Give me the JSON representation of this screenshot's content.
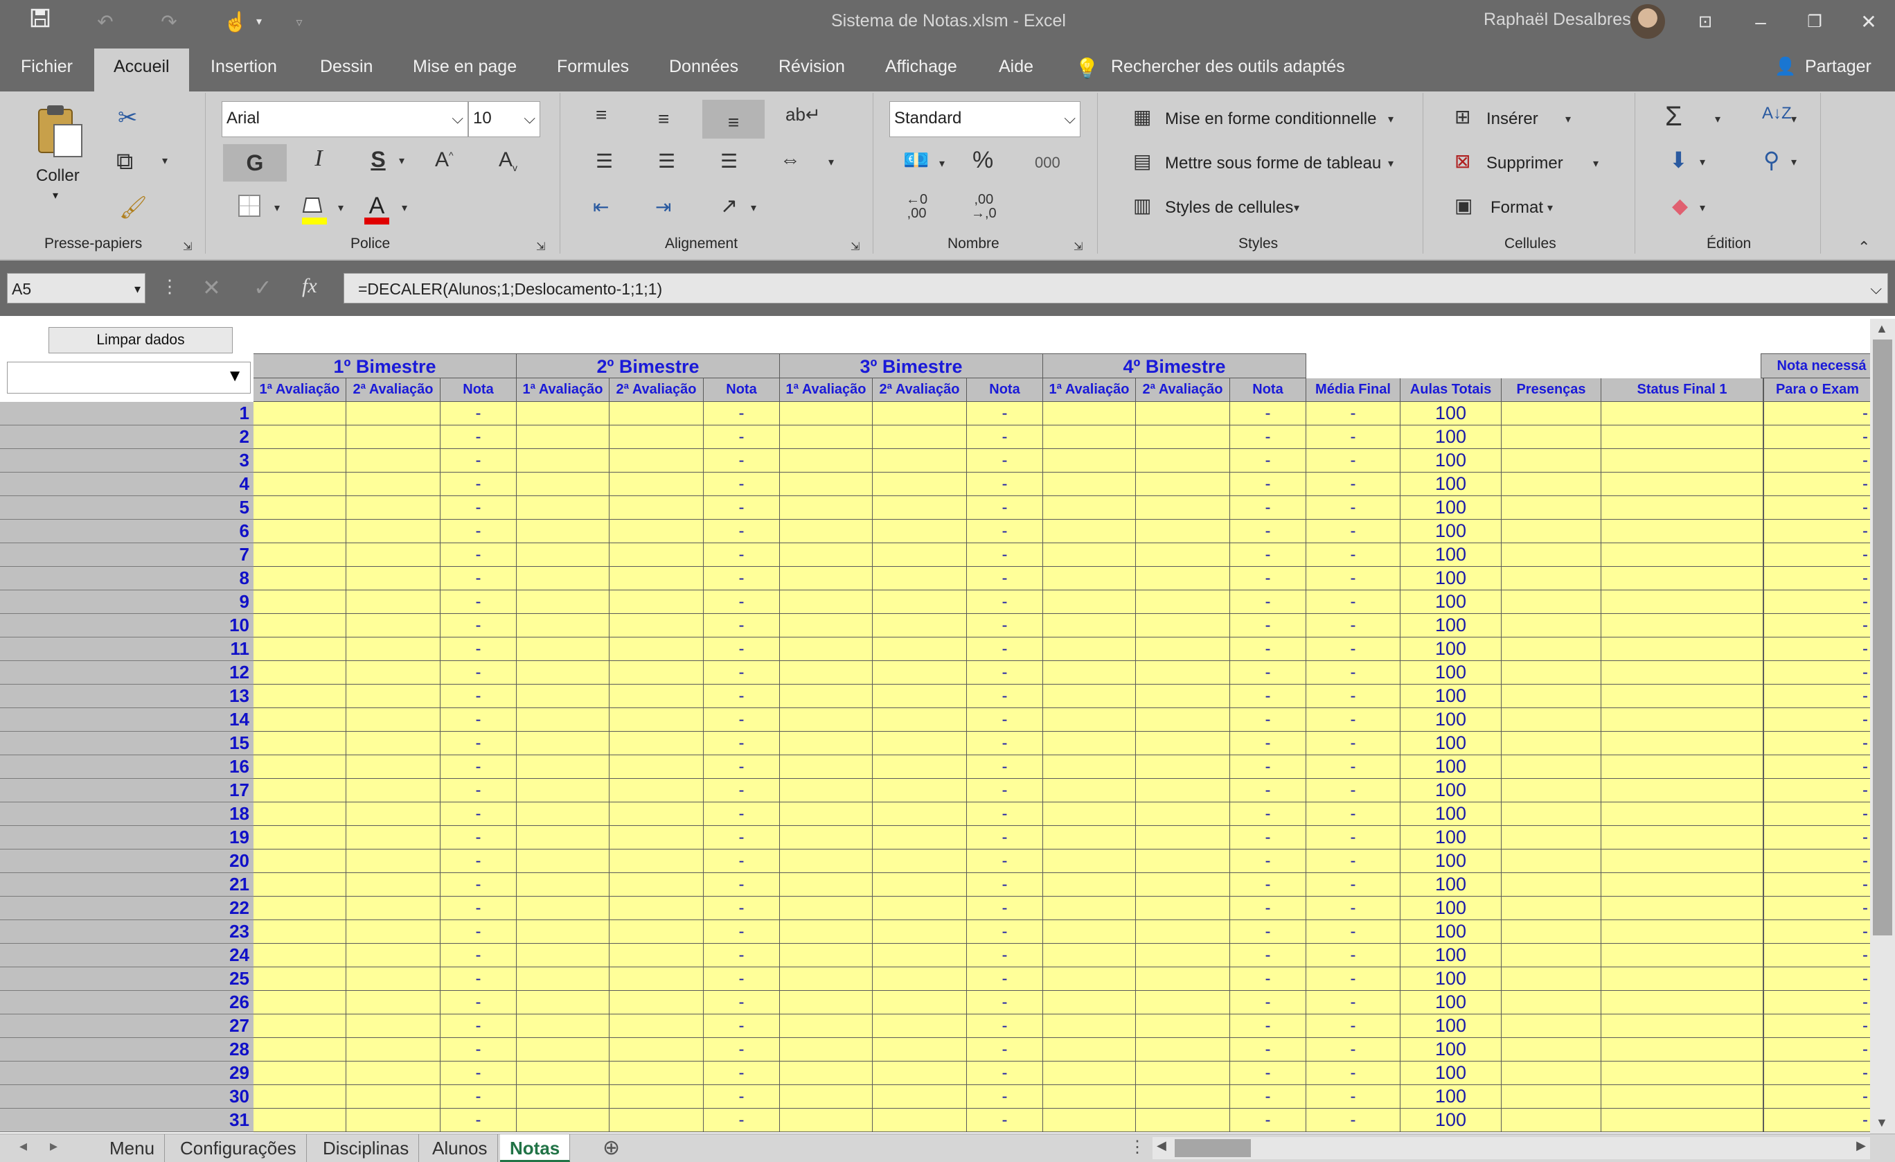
{
  "titlebar": {
    "document": "Sistema de Notas.xlsm  -  Excel",
    "user": "Raphaël Desalbres"
  },
  "ribbon_tabs": [
    "Fichier",
    "Accueil",
    "Insertion",
    "Dessin",
    "Mise en page",
    "Formules",
    "Données",
    "Révision",
    "Affichage",
    "Aide"
  ],
  "active_tab": "Accueil",
  "search_hint": "Rechercher des outils adaptés",
  "share_label": "Partager",
  "clipboard": {
    "paste_label": "Coller",
    "group": "Presse-papiers"
  },
  "font": {
    "name": "Arial",
    "size": "10",
    "bold": "G",
    "italic": "I",
    "underline": "S",
    "group": "Police"
  },
  "alignment": {
    "group": "Alignement"
  },
  "number": {
    "format": "Standard",
    "group": "Nombre"
  },
  "styles": {
    "conditional": "Mise en forme conditionnelle",
    "table": "Mettre sous forme de tableau",
    "cell_styles": "Styles de cellules",
    "group": "Styles"
  },
  "cells": {
    "insert": "Insérer",
    "delete": "Supprimer",
    "format": "Format",
    "group": "Cellules"
  },
  "editing": {
    "group": "Édition"
  },
  "formula_bar": {
    "name_box": "A5",
    "formula": "=DECALER(Alunos;1;Deslocamento-1;1;1)",
    "fx": "fx"
  },
  "sheet": {
    "clear_button": "Limpar dados",
    "bimesters": [
      "1º Bimestre",
      "2º Bimestre",
      "3º Bimestre",
      "4º Bimestre"
    ],
    "sub_headers": [
      "1ª Avaliação",
      "2ª Avaliação",
      "Nota"
    ],
    "extra_headers": [
      "Média Final",
      "Aulas Totais",
      "Presenças",
      "Status Final 1"
    ],
    "exam_header_1": "Nota necessá",
    "exam_header_2": "Para o Exam",
    "dash": "-",
    "total_classes": "100",
    "rows": [
      "1",
      "2",
      "3",
      "4",
      "5",
      "6",
      "7",
      "8",
      "9",
      "10",
      "11",
      "12",
      "13",
      "14",
      "15",
      "16",
      "17",
      "18",
      "19",
      "20",
      "21",
      "22",
      "23",
      "24",
      "25",
      "26",
      "27",
      "28",
      "29",
      "30",
      "31"
    ]
  },
  "sheet_tabs": [
    "Menu",
    "Configurações",
    "Disciplinas",
    "Alunos",
    "Notas"
  ],
  "active_sheet": "Notas",
  "colors": {
    "cell_fill": "#ffff99",
    "header_text": "#1a1ad8",
    "header_fill": "#c0c0c0",
    "chrome": "#6a6a6a",
    "ribbon": "#cfcfcf"
  }
}
